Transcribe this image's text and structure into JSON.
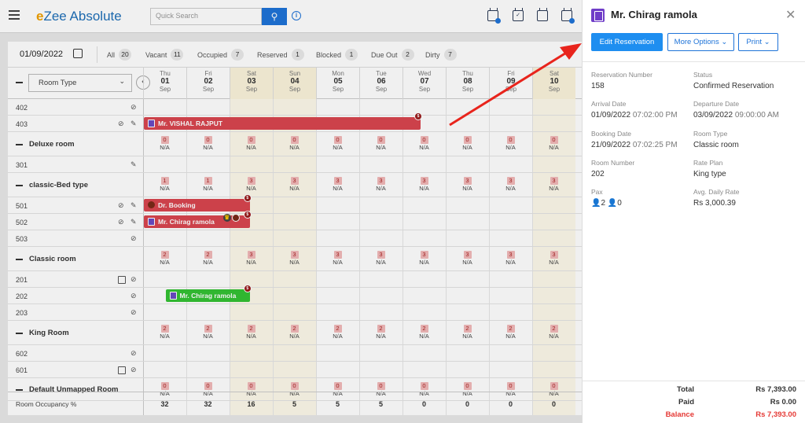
{
  "app": {
    "logo_prefix": "e",
    "logo_text": "Zee Absolute",
    "search_placeholder": "Quick Search"
  },
  "filter": {
    "date": "01/09/2022",
    "items": [
      {
        "label": "All",
        "count": "20"
      },
      {
        "label": "Vacant",
        "count": "11"
      },
      {
        "label": "Occupied",
        "count": "7"
      },
      {
        "label": "Reserved",
        "count": "1"
      },
      {
        "label": "Blocked",
        "count": "1"
      },
      {
        "label": "Due Out",
        "count": "2"
      },
      {
        "label": "Dirty",
        "count": "7"
      }
    ]
  },
  "grid": {
    "room_type_select": "Room Type",
    "days": [
      {
        "dn": "Thu",
        "dd": "01",
        "dm": "Sep",
        "weekend": false
      },
      {
        "dn": "Fri",
        "dd": "02",
        "dm": "Sep",
        "weekend": false
      },
      {
        "dn": "Sat",
        "dd": "03",
        "dm": "Sep",
        "weekend": true
      },
      {
        "dn": "Sun",
        "dd": "04",
        "dm": "Sep",
        "weekend": true
      },
      {
        "dn": "Mon",
        "dd": "05",
        "dm": "Sep",
        "weekend": false
      },
      {
        "dn": "Tue",
        "dd": "06",
        "dm": "Sep",
        "weekend": false
      },
      {
        "dn": "Wed",
        "dd": "07",
        "dm": "Sep",
        "weekend": false
      },
      {
        "dn": "Thu",
        "dd": "08",
        "dm": "Sep",
        "weekend": false
      },
      {
        "dn": "Fri",
        "dd": "09",
        "dm": "Sep",
        "weekend": false
      },
      {
        "dn": "Sat",
        "dd": "10",
        "dm": "Sep",
        "weekend": true
      }
    ],
    "na": "N/A",
    "rows": [
      {
        "kind": "room",
        "label": "402",
        "icons": [
          "nosmoke"
        ]
      },
      {
        "kind": "room",
        "label": "403",
        "icons": [
          "nosmoke",
          "broom"
        ]
      },
      {
        "kind": "cat",
        "label": "Deluxe room",
        "counts": [
          "0",
          "0",
          "0",
          "0",
          "0",
          "0",
          "0",
          "0",
          "0",
          "0"
        ]
      },
      {
        "kind": "room",
        "label": "301",
        "icons": [
          "broom"
        ]
      },
      {
        "kind": "cat",
        "label": "classic-Bed type",
        "counts": [
          "1",
          "1",
          "3",
          "3",
          "3",
          "3",
          "3",
          "3",
          "3",
          "3"
        ]
      },
      {
        "kind": "room",
        "label": "501",
        "icons": [
          "nosmoke",
          "broom"
        ]
      },
      {
        "kind": "room",
        "label": "502",
        "icons": [
          "nosmoke",
          "broom"
        ]
      },
      {
        "kind": "room",
        "label": "503",
        "icons": [
          "nosmoke"
        ]
      },
      {
        "kind": "cat",
        "label": "Classic room",
        "counts": [
          "2",
          "2",
          "3",
          "3",
          "3",
          "3",
          "3",
          "3",
          "3",
          "3"
        ]
      },
      {
        "kind": "room",
        "label": "201",
        "icons": [
          "check",
          "nosmoke"
        ]
      },
      {
        "kind": "room",
        "label": "202",
        "icons": [
          "nosmoke"
        ]
      },
      {
        "kind": "room",
        "label": "203",
        "icons": [
          "nosmoke"
        ]
      },
      {
        "kind": "cat",
        "label": "King Room",
        "counts": [
          "2",
          "2",
          "2",
          "2",
          "2",
          "2",
          "2",
          "2",
          "2",
          "2"
        ]
      },
      {
        "kind": "room",
        "label": "602",
        "icons": [
          "nosmoke"
        ]
      },
      {
        "kind": "room",
        "label": "601",
        "icons": [
          "check",
          "nosmoke"
        ]
      },
      {
        "kind": "cat",
        "label": "Default Unmapped Room",
        "counts": [
          "0",
          "0",
          "0",
          "0",
          "0",
          "0",
          "0",
          "0",
          "0",
          "0"
        ]
      }
    ],
    "bookings": [
      {
        "name": "Mr. VISHAL RAJPUT",
        "color": "#d9464f",
        "marker": "icon"
      },
      {
        "name": "Dr. Booking",
        "color": "#d9464f",
        "marker": "dot"
      },
      {
        "name": "Mr. Chirag ramola",
        "color": "#d9464f",
        "marker": "icon"
      },
      {
        "name": "Mr. Chirag ramola",
        "color": "#33c233",
        "marker": "icon"
      }
    ],
    "occupancy_label": "Room Occupancy %",
    "occupancy": [
      "32",
      "32",
      "16",
      "5",
      "5",
      "5",
      "0",
      "0",
      "0",
      "0"
    ]
  },
  "panel": {
    "title": "Mr. Chirag ramola",
    "buttons": {
      "edit": "Edit Reservation",
      "more": "More Options",
      "print": "Print"
    },
    "fields": [
      {
        "label": "Reservation Number",
        "value": "158"
      },
      {
        "label": "Status",
        "value": "Confirmed Reservation"
      },
      {
        "label": "Arrival Date",
        "value": "01/09/2022",
        "sub": "07:02:00 PM"
      },
      {
        "label": "Departure Date",
        "value": "03/09/2022",
        "sub": "09:00:00 AM"
      },
      {
        "label": "Booking Date",
        "value": "21/09/2022",
        "sub": "07:02:25 PM"
      },
      {
        "label": "Room Type",
        "value": "Classic room"
      },
      {
        "label": "Room Number",
        "value": "202"
      },
      {
        "label": "Rate Plan",
        "value": "King type"
      },
      {
        "label": "Pax",
        "adults": "2",
        "children": "0"
      },
      {
        "label": "Avg. Daily Rate",
        "value": "Rs 3,000.39"
      }
    ],
    "totals": [
      {
        "label": "Total",
        "value": "Rs 7,393.00"
      },
      {
        "label": "Paid",
        "value": "Rs 0.00"
      },
      {
        "label": "Balance",
        "value": "Rs 7,393.00",
        "highlight": true
      }
    ]
  },
  "colors": {
    "accent": "#1e8ef0",
    "booking_red": "#d9464f",
    "booking_green": "#33c233",
    "balance_red": "#e53935",
    "arrow": "#e8241c"
  }
}
